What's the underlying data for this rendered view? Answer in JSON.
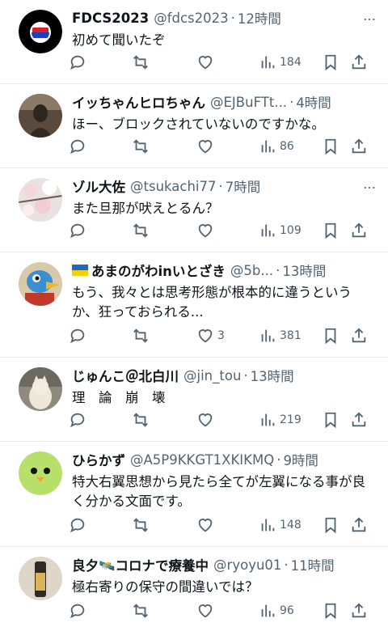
{
  "posts": [
    {
      "name": "FDCS2023",
      "handle": "@fdcs2023",
      "time": "12時間",
      "text": "初めて聞いたぞ",
      "views": "184",
      "likes": "",
      "avatar": "fdcs-logo"
    },
    {
      "name": "イッちゃんヒロちゃん",
      "handle": "@EJBuFTt...",
      "time": "4時間",
      "text": "ほー、ブロックされていないのですかな。",
      "views": "86",
      "likes": "",
      "avatar": "buddha-statue"
    },
    {
      "name": "ゾル大佐",
      "handle": "@tsukachi77",
      "time": "7時間",
      "text": "また旦那が吠えとるん？",
      "views": "109",
      "likes": "",
      "avatar": "cherry-blossoms"
    },
    {
      "name": "あまのがわinいとざき",
      "handle": "@5b...",
      "time": "13時間",
      "text": "もう、我々とは思考形態が根本的に違うというか、狂っておられる...",
      "views": "381",
      "likes": "3",
      "avatar": "bird-character",
      "flag": "ukraine-flag"
    },
    {
      "name": "じゅんこ＠北白川",
      "handle": "@jin_tou",
      "time": "13時間",
      "text": "理　論　崩　壊",
      "views": "219",
      "likes": "",
      "avatar": "cat-photo"
    },
    {
      "name": "ひらかず",
      "handle": "@A5P9KKGT1XKIKMQ",
      "time": "9時間",
      "text": "特大右翼思想から見たら全てが左翼になる事が良く分かる文面です。",
      "views": "148",
      "likes": "",
      "avatar": "green-bird"
    },
    {
      "name": "良夕🛰️コロナで療養中",
      "handle": "@ryoyu01",
      "time": "11時間",
      "text": "極右寄りの保守の間違いでは？",
      "views": "96",
      "likes": "",
      "avatar": "bottle-photo"
    }
  ],
  "more_label": "…",
  "colors": {
    "text": "#0f1419",
    "secondary": "#536471",
    "divider": "#e8ecef"
  }
}
